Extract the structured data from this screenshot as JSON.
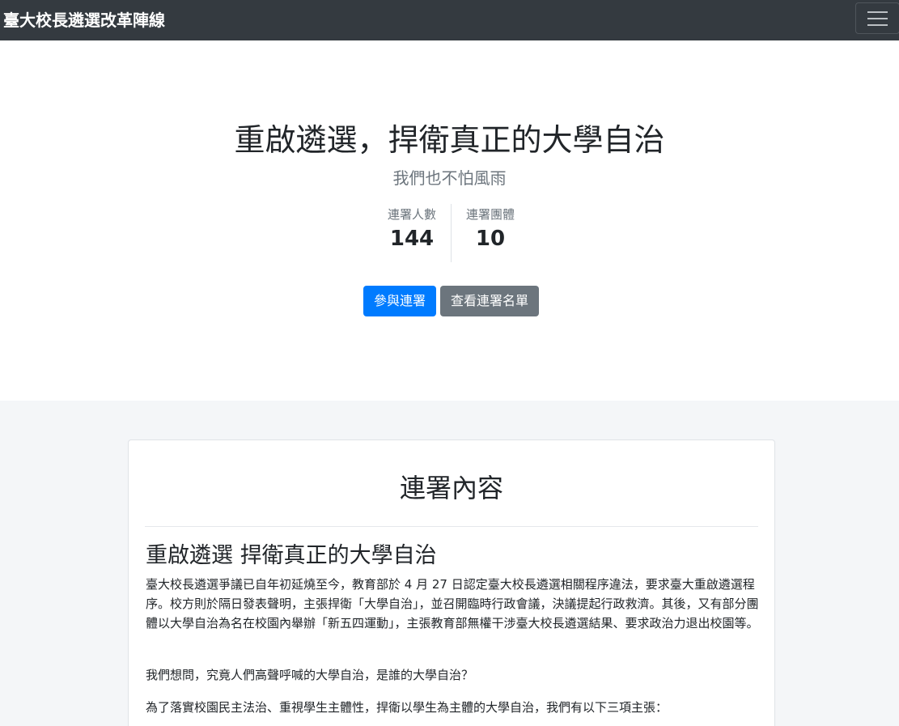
{
  "navbar": {
    "brand": "臺大校長遴選改革陣線",
    "menu_icon": "hamburger-menu-icon"
  },
  "hero": {
    "title": "重啟遴選，捍衛真正的大學自治",
    "subtitle": "我們也不怕風雨",
    "stats": [
      {
        "label": "連署人數",
        "value": "144"
      },
      {
        "label": "連署團體",
        "value": "10"
      }
    ],
    "buttons": {
      "join": "參與連署",
      "view_list": "查看連署名單"
    }
  },
  "content": {
    "heading": "連署內容",
    "article_title": "重啟遴選 捍衛真正的大學自治",
    "paragraphs": [
      "臺大校長遴選爭議已自年初延燒至今，教育部於 4 月 27 日認定臺大校長遴選相關程序違法，要求臺大重啟遴選程序。校方則於隔日發表聲明，主張捍衛「大學自治」，並召開臨時行政會議，決議提起行政救濟。其後，又有部分團體以大學自治為名在校園內舉辦「新五四運動」，主張教育部無權干涉臺大校長遴選結果、要求政治力退出校園等。",
      "我們想問，究竟人們高聲呼喊的大學自治，是誰的大學自治？",
      "為了落實校園民主法治、重視學生主體性，捍衛以學生為主體的大學自治，我們有以下三項主張："
    ]
  },
  "colors": {
    "navbar_bg": "#343a40",
    "primary": "#007bff",
    "secondary": "#6c757d",
    "page_bg": "#f4f6f8"
  }
}
